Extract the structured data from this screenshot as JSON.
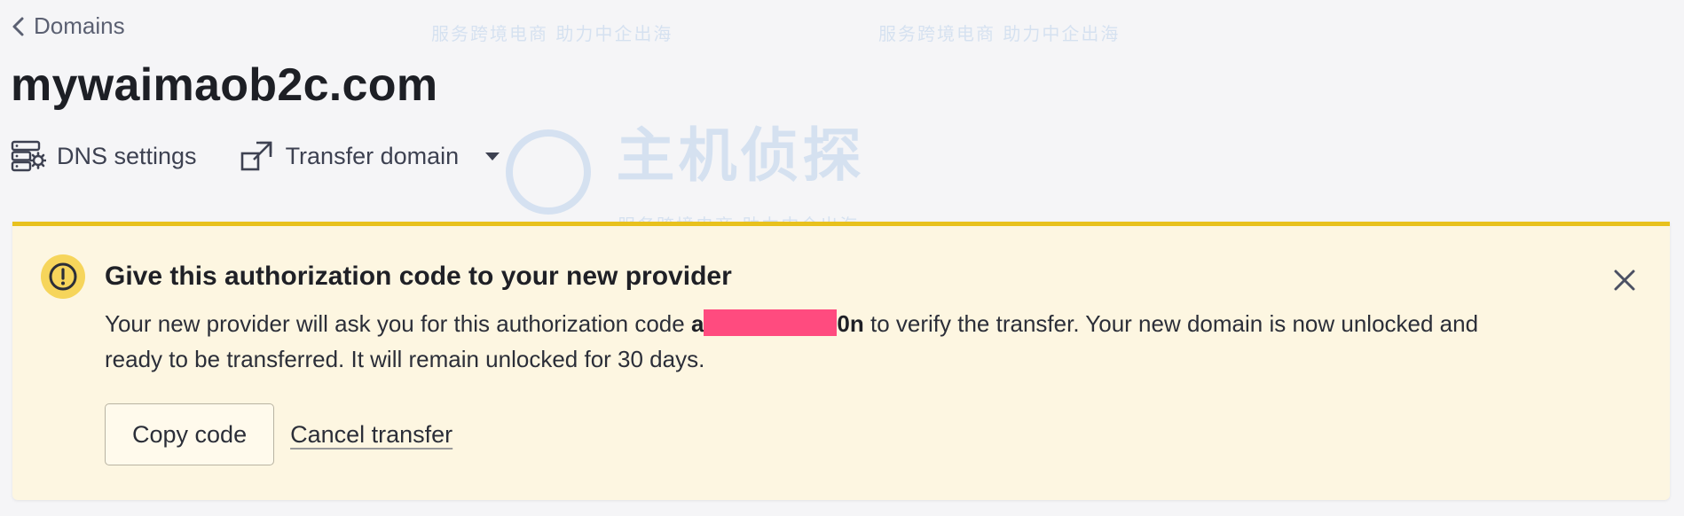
{
  "breadcrumb": {
    "label": "Domains",
    "icon": "chevron-left-icon"
  },
  "page": {
    "title": "mywaimaob2c.com"
  },
  "toolbar": {
    "dns_label": "DNS settings",
    "dns_icon": "server-gear-icon",
    "transfer_label": "Transfer domain",
    "transfer_icon": "external-transfer-icon",
    "transfer_menu_icon": "caret-down-icon"
  },
  "alert": {
    "title": "Give this authorization code to your new provider",
    "body_before": "Your new provider will ask you for this authorization code ",
    "code_start": "a",
    "code_end": "0n",
    "body_after": " to verify the transfer. Your new domain is now unlocked and ready to be transferred. It will remain unlocked for 30 days.",
    "copy_button": "Copy code",
    "cancel_link": "Cancel transfer",
    "icon": "warning-exclamation-icon",
    "close_icon": "close-icon",
    "colors": {
      "background": "#fdf6e1",
      "top_border": "#e8c11d",
      "icon_bg": "#f6d55b",
      "redaction": "#ff4b7f"
    }
  },
  "watermark": {
    "main": "主机侦探",
    "sub": "服务跨境电商 助力中企出海"
  }
}
